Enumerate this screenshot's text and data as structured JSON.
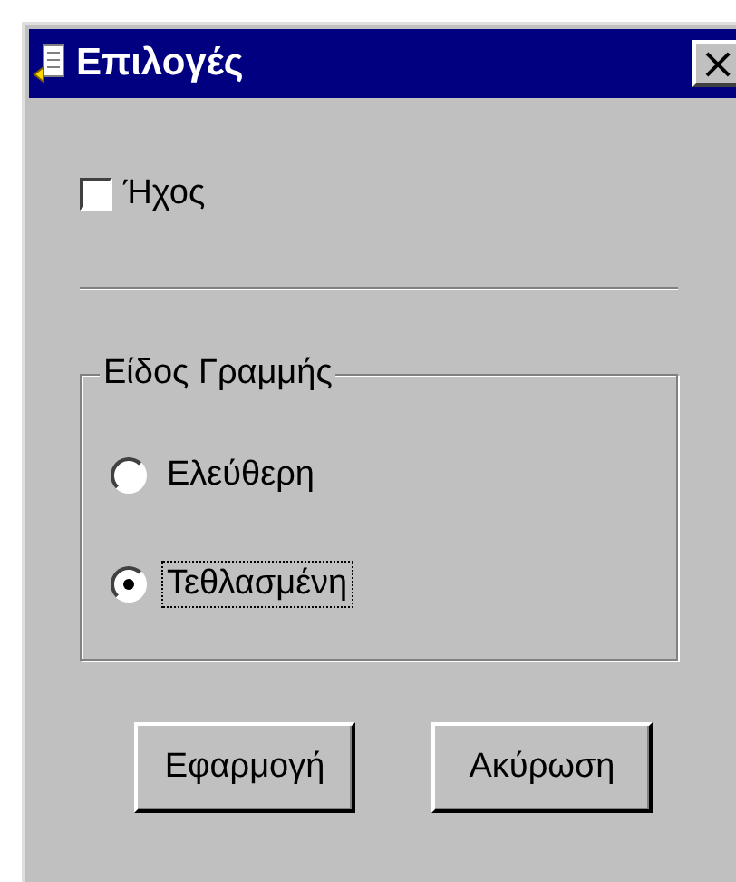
{
  "window": {
    "title": "Επιλογές",
    "close": "×"
  },
  "sound": {
    "label": "Ήχος",
    "checked": false
  },
  "line_type": {
    "legend": "Είδος Γραμμής",
    "options": [
      {
        "label": "Ελεύθερη",
        "selected": false,
        "focused": false
      },
      {
        "label": "Τεθλασμένη",
        "selected": true,
        "focused": true
      }
    ]
  },
  "buttons": [
    "Εφαρμογή",
    "Ακύρωση"
  ]
}
